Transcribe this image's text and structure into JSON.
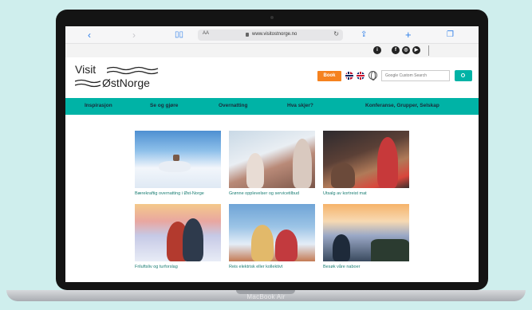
{
  "device": {
    "label": "MacBook Air"
  },
  "browser": {
    "text_size_label": "AA",
    "url": "www.visitostnorge.no"
  },
  "site": {
    "logo": {
      "line1": "Visit",
      "line2": "ØstNorge"
    },
    "book_label": "Book",
    "search": {
      "placeholder": "Google Custom Search"
    },
    "nav": [
      {
        "label": "Inspirasjon"
      },
      {
        "label": "Se og gjøre"
      },
      {
        "label": "Overnatting"
      },
      {
        "label": "Hva skjer?"
      },
      {
        "label": "Konferanse, Grupper, Selskap"
      }
    ],
    "cards": [
      {
        "caption": "Bærekraftig overnatting i Øst-Norge"
      },
      {
        "caption": "Grønne opplevelser og servicetilbud"
      },
      {
        "caption": "Utsalg av kortreist mat"
      },
      {
        "caption": "Friluftsliv og turforslag"
      },
      {
        "caption": "Reis elektrisk eller kollektivt"
      },
      {
        "caption": "Besøk våre naboer"
      }
    ]
  },
  "colors": {
    "accent": "#00b3a6",
    "book": "#f5821f",
    "background": "#cfeeed",
    "link": "#1a7d73"
  }
}
